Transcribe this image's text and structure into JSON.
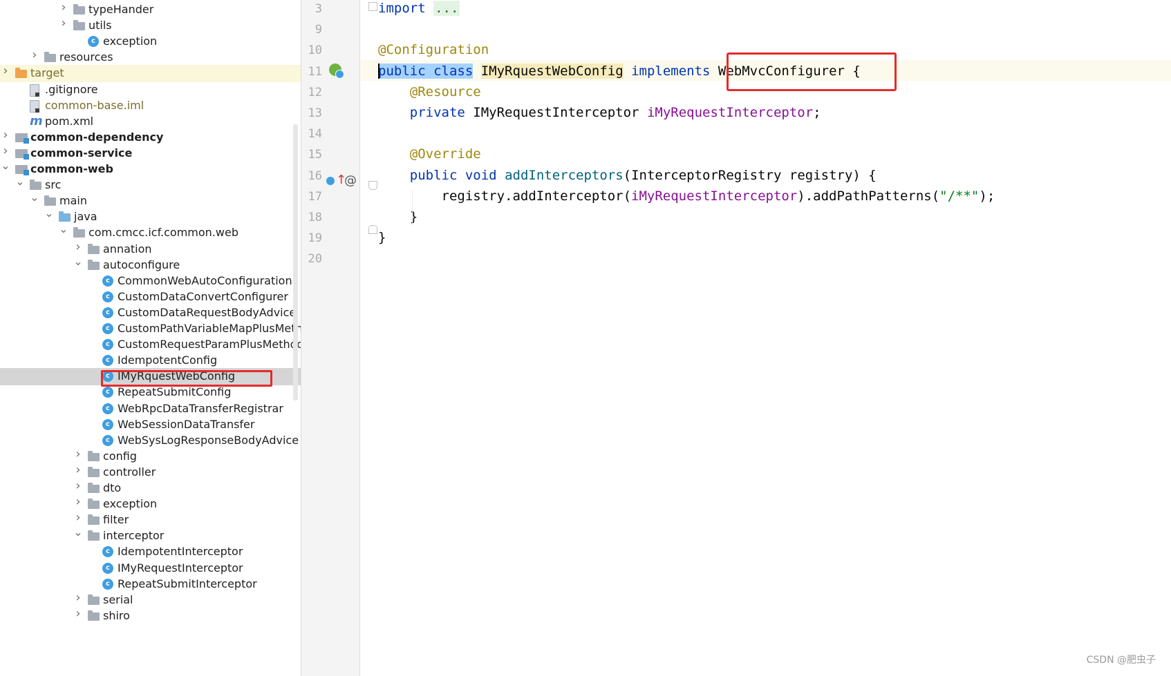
{
  "project_tree": {
    "rows": [
      {
        "label": "typeHander",
        "kind": "folder",
        "indent": 5,
        "expander": "collapsed"
      },
      {
        "label": "utils",
        "kind": "folder",
        "indent": 5,
        "expander": "collapsed"
      },
      {
        "label": "exception",
        "kind": "class",
        "indent": 6,
        "expander": "none"
      },
      {
        "label": "resources",
        "kind": "folder",
        "indent": 3,
        "expander": "collapsed"
      },
      {
        "label": "target",
        "kind": "folder-orange",
        "indent": 1,
        "expander": "collapsed",
        "style": "modified",
        "highlight": "yellow"
      },
      {
        "label": ".gitignore",
        "kind": "file",
        "indent": 2,
        "expander": "none"
      },
      {
        "label": "common-base.iml",
        "kind": "file",
        "indent": 2,
        "expander": "none",
        "style": "modified"
      },
      {
        "label": "pom.xml",
        "kind": "maven",
        "indent": 2,
        "expander": "none"
      },
      {
        "label": "common-dependency",
        "kind": "module",
        "indent": 1,
        "expander": "collapsed",
        "style": "bold"
      },
      {
        "label": "common-service",
        "kind": "module",
        "indent": 1,
        "expander": "collapsed",
        "style": "bold"
      },
      {
        "label": "common-web",
        "kind": "module",
        "indent": 1,
        "expander": "expanded",
        "style": "bold"
      },
      {
        "label": "src",
        "kind": "folder",
        "indent": 2,
        "expander": "expanded"
      },
      {
        "label": "main",
        "kind": "folder",
        "indent": 3,
        "expander": "expanded"
      },
      {
        "label": "java",
        "kind": "folder-blue",
        "indent": 4,
        "expander": "expanded"
      },
      {
        "label": "com.cmcc.icf.common.web",
        "kind": "folder",
        "indent": 5,
        "expander": "expanded"
      },
      {
        "label": "annation",
        "kind": "folder",
        "indent": 6,
        "expander": "collapsed"
      },
      {
        "label": "autoconfigure",
        "kind": "folder",
        "indent": 6,
        "expander": "expanded"
      },
      {
        "label": "CommonWebAutoConfiguration",
        "kind": "class",
        "indent": 7,
        "expander": "none"
      },
      {
        "label": "CustomDataConvertConfigurer",
        "kind": "class",
        "indent": 7,
        "expander": "none"
      },
      {
        "label": "CustomDataRequestBodyAdvice",
        "kind": "class",
        "indent": 7,
        "expander": "none"
      },
      {
        "label": "CustomPathVariableMapPlusMetho",
        "kind": "class",
        "indent": 7,
        "expander": "none"
      },
      {
        "label": "CustomRequestParamPlusMethodA",
        "kind": "class",
        "indent": 7,
        "expander": "none"
      },
      {
        "label": "IdempotentConfig",
        "kind": "class",
        "indent": 7,
        "expander": "none"
      },
      {
        "label": "IMyRquestWebConfig",
        "kind": "class",
        "indent": 7,
        "expander": "none",
        "highlight": "selected"
      },
      {
        "label": "RepeatSubmitConfig",
        "kind": "class",
        "indent": 7,
        "expander": "none"
      },
      {
        "label": "WebRpcDataTransferRegistrar",
        "kind": "class",
        "indent": 7,
        "expander": "none"
      },
      {
        "label": "WebSessionDataTransfer",
        "kind": "class",
        "indent": 7,
        "expander": "none"
      },
      {
        "label": "WebSysLogResponseBodyAdvice",
        "kind": "class",
        "indent": 7,
        "expander": "none"
      },
      {
        "label": "config",
        "kind": "folder",
        "indent": 6,
        "expander": "collapsed"
      },
      {
        "label": "controller",
        "kind": "folder",
        "indent": 6,
        "expander": "collapsed"
      },
      {
        "label": "dto",
        "kind": "folder",
        "indent": 6,
        "expander": "collapsed"
      },
      {
        "label": "exception",
        "kind": "folder",
        "indent": 6,
        "expander": "collapsed"
      },
      {
        "label": "filter",
        "kind": "folder",
        "indent": 6,
        "expander": "collapsed"
      },
      {
        "label": "interceptor",
        "kind": "folder",
        "indent": 6,
        "expander": "expanded"
      },
      {
        "label": "IdempotentInterceptor",
        "kind": "class",
        "indent": 7,
        "expander": "none"
      },
      {
        "label": "IMyRequestInterceptor",
        "kind": "class",
        "indent": 7,
        "expander": "none"
      },
      {
        "label": "RepeatSubmitInterceptor",
        "kind": "class",
        "indent": 7,
        "expander": "none"
      },
      {
        "label": "serial",
        "kind": "folder",
        "indent": 6,
        "expander": "collapsed"
      },
      {
        "label": "shiro",
        "kind": "folder",
        "indent": 6,
        "expander": "collapsed"
      }
    ]
  },
  "editor": {
    "lines": [
      {
        "num": "3",
        "tokens": [
          {
            "t": "import",
            "c": "kw"
          },
          {
            "t": " ",
            "c": ""
          },
          {
            "t": "...",
            "c": "fold-dots"
          }
        ]
      },
      {
        "num": "9",
        "tokens": []
      },
      {
        "num": "10",
        "tokens": [
          {
            "t": "@Configuration",
            "c": "ann"
          }
        ]
      },
      {
        "num": "11",
        "tokens": [
          {
            "t": "public class",
            "c": "kw sel-bg"
          },
          {
            "t": " ",
            "c": ""
          },
          {
            "t": "IMyRquestWebConfig",
            "c": "cls-hl"
          },
          {
            "t": " ",
            "c": ""
          },
          {
            "t": "implements",
            "c": "kw"
          },
          {
            "t": " WebMvcConfigurer {",
            "c": ""
          }
        ]
      },
      {
        "num": "12",
        "tokens": [
          {
            "t": "    ",
            "c": ""
          },
          {
            "t": "@Resource",
            "c": "ann"
          }
        ]
      },
      {
        "num": "13",
        "tokens": [
          {
            "t": "    ",
            "c": ""
          },
          {
            "t": "private",
            "c": "kw"
          },
          {
            "t": " IMyRequestInterceptor ",
            "c": ""
          },
          {
            "t": "iMyRequestInterceptor",
            "c": "fld"
          },
          {
            "t": ";",
            "c": ""
          }
        ]
      },
      {
        "num": "14",
        "tokens": []
      },
      {
        "num": "15",
        "tokens": [
          {
            "t": "    ",
            "c": ""
          },
          {
            "t": "@Override",
            "c": "ann"
          }
        ]
      },
      {
        "num": "16",
        "tokens": [
          {
            "t": "    ",
            "c": ""
          },
          {
            "t": "public void",
            "c": "kw"
          },
          {
            "t": " ",
            "c": ""
          },
          {
            "t": "addInterceptors",
            "c": "mth"
          },
          {
            "t": "(InterceptorRegistry registry) {",
            "c": ""
          }
        ]
      },
      {
        "num": "17",
        "tokens": [
          {
            "t": "        registry.addInterceptor(",
            "c": ""
          },
          {
            "t": "iMyRequestInterceptor",
            "c": "fld"
          },
          {
            "t": ").addPathPatterns(",
            "c": ""
          },
          {
            "t": "\"/**\"",
            "c": "str"
          },
          {
            "t": ");",
            "c": ""
          }
        ]
      },
      {
        "num": "18",
        "tokens": [
          {
            "t": "    }",
            "c": ""
          }
        ]
      },
      {
        "num": "19",
        "tokens": [
          {
            "t": "}",
            "c": ""
          }
        ]
      },
      {
        "num": "20",
        "tokens": []
      }
    ]
  },
  "watermark": "CSDN @肥虫子"
}
